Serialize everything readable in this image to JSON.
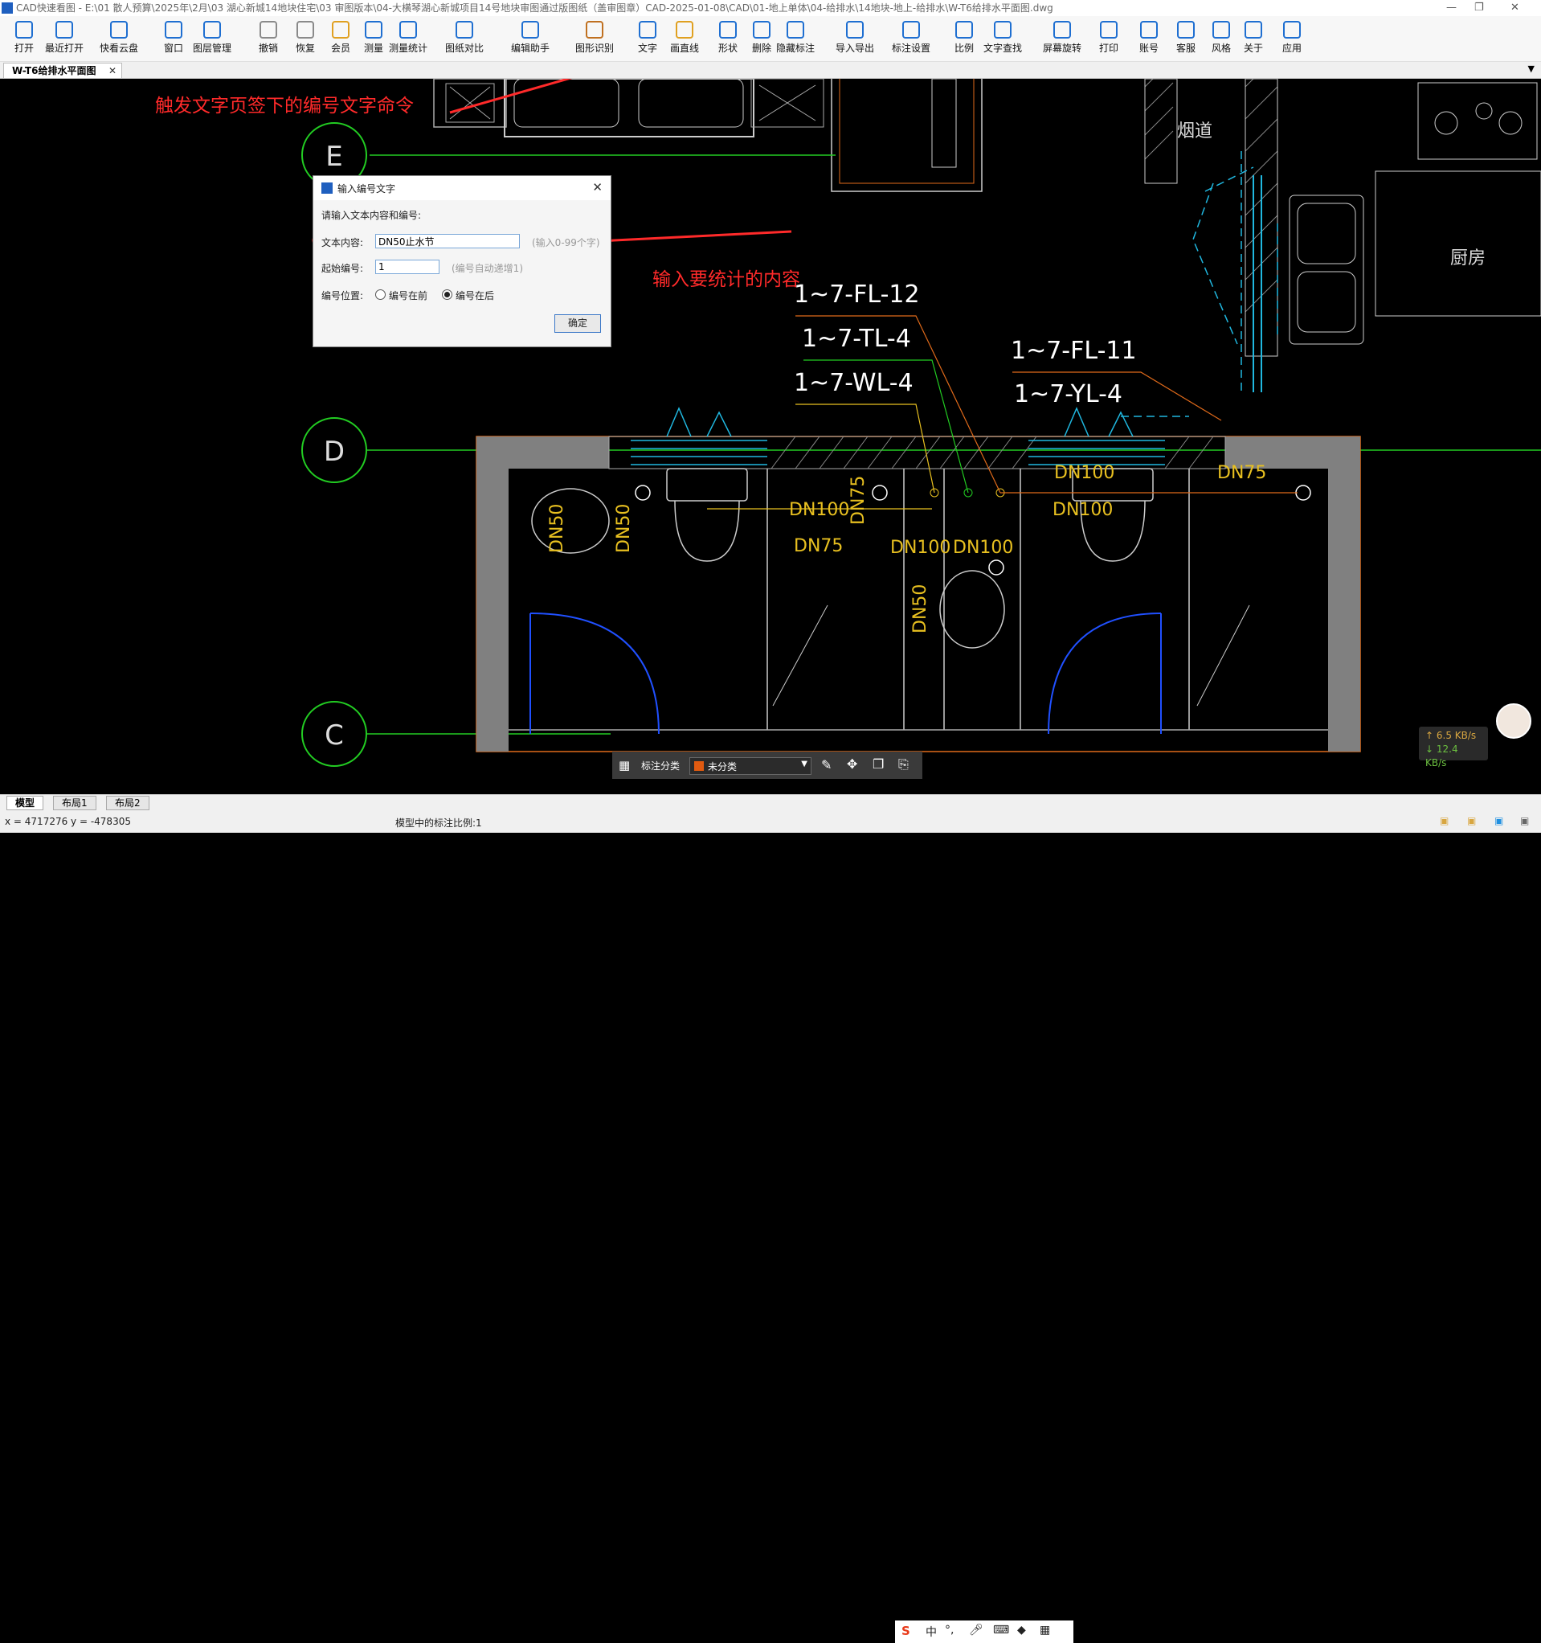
{
  "window": {
    "title": "CAD快速看图 - E:\\01 散人预算\\2025年\\2月\\03 湖心新城14地块住宅\\03 审图版本\\04-大横琴湖心新城项目14号地块审图通过版图纸（盖审图章）CAD-2025-01-08\\CAD\\01-地上单体\\04-给排水\\14地块-地上-给排水\\W-T6给排水平面图.dwg",
    "minimize": "—",
    "restore": "❐",
    "close": "✕"
  },
  "toolbar": [
    {
      "id": "open",
      "label": "打开",
      "icon": "folder-open-icon"
    },
    {
      "id": "recent",
      "label": "最近打开",
      "icon": "clock-icon"
    },
    {
      "id": "cloud",
      "label": "快看云盘",
      "icon": "cloud-icon"
    },
    {
      "id": "window",
      "label": "窗口",
      "icon": "window-icon"
    },
    {
      "id": "layers",
      "label": "图层管理",
      "icon": "layers-icon"
    },
    {
      "id": "undo",
      "label": "撤销",
      "icon": "undo-icon"
    },
    {
      "id": "redo",
      "label": "恢复",
      "icon": "redo-icon"
    },
    {
      "id": "vip",
      "label": "会员",
      "icon": "vip-icon"
    },
    {
      "id": "measure",
      "label": "测量",
      "icon": "ruler-icon"
    },
    {
      "id": "measure-stats",
      "label": "测量统计",
      "icon": "measure-stats-icon"
    },
    {
      "id": "compare",
      "label": "图纸对比",
      "icon": "compare-icon"
    },
    {
      "id": "edit-assist",
      "label": "编辑助手",
      "icon": "edit-assist-icon"
    },
    {
      "id": "shape-recog",
      "label": "图形识别",
      "icon": "shape-recognition-icon"
    },
    {
      "id": "text",
      "label": "文字",
      "icon": "text-icon"
    },
    {
      "id": "line",
      "label": "画直线",
      "icon": "line-icon"
    },
    {
      "id": "shape",
      "label": "形状",
      "icon": "shape-icon"
    },
    {
      "id": "delete",
      "label": "删除",
      "icon": "eraser-icon"
    },
    {
      "id": "hide",
      "label": "隐藏标注",
      "icon": "hide-eye-icon"
    },
    {
      "id": "import-export",
      "label": "导入导出",
      "icon": "import-export-icon"
    },
    {
      "id": "anno-settings",
      "label": "标注设置",
      "icon": "annotation-settings-icon"
    },
    {
      "id": "scale",
      "label": "比例",
      "icon": "scale-icon"
    },
    {
      "id": "text-search",
      "label": "文字查找",
      "icon": "text-search-icon"
    },
    {
      "id": "rotate",
      "label": "屏幕旋转",
      "icon": "rotate-screen-icon"
    },
    {
      "id": "print",
      "label": "打印",
      "icon": "printer-icon"
    },
    {
      "id": "account",
      "label": "账号",
      "icon": "user-icon"
    },
    {
      "id": "service",
      "label": "客服",
      "icon": "headset-icon"
    },
    {
      "id": "style",
      "label": "风格",
      "icon": "style-icon"
    },
    {
      "id": "about",
      "label": "关于",
      "icon": "info-icon"
    },
    {
      "id": "apps",
      "label": "应用",
      "icon": "cube-icon"
    }
  ],
  "doc_tab": {
    "label": "W-T6给排水平面图",
    "close": "✕"
  },
  "annotations": {
    "top": "触发文字页签下的编号文字命令",
    "input": "输入要统计的内容"
  },
  "dialog": {
    "title": "输入编号文字",
    "prompt": "请输入文本内容和编号:",
    "content_label": "文本内容:",
    "content_value": "DN50止水节",
    "content_hint": "(输入0-99个字)",
    "start_label": "起始编号:",
    "start_value": "1",
    "start_hint": "(编号自动递增1)",
    "position_label": "编号位置:",
    "option_before": "编号在前",
    "option_after": "编号在后",
    "selected": "编号在后",
    "ok": "确定"
  },
  "drawing": {
    "axis_labels": [
      "E",
      "D",
      "C"
    ],
    "pipe_labels": [
      "1~7-FL-12",
      "1~7-TL-4",
      "1~7-WL-4",
      "1~7-FL-11",
      "1~7-YL-4"
    ],
    "dn_labels": [
      "DN100",
      "DN100",
      "DN100",
      "DN100",
      "DN100",
      "DN75",
      "DN75",
      "DN50",
      "DN50",
      "DN50",
      "DN75"
    ],
    "room_labels": [
      "烟道",
      "厨房"
    ],
    "colors": {
      "axis": "#22cc22",
      "pipe_label": "#ffffff",
      "dn": "#e8c020",
      "wall": "#808080",
      "orange": "#e06a1a",
      "cyan": "#20b8e0",
      "annotation": "#ff2a2a"
    }
  },
  "float_toolbar": {
    "label": "标注分类",
    "category": "未分类"
  },
  "layout_tabs": [
    "模型",
    "布局1",
    "布局2"
  ],
  "status": {
    "coords": "x = 4717276  y = -478305",
    "scale": "模型中的标注比例:1"
  },
  "network": {
    "up": "↑ 6.5 KB/s",
    "down": "↓ 12.4 KB/s"
  },
  "ime": {
    "s_logo": "S",
    "lang": "中",
    "punct": "°,"
  }
}
